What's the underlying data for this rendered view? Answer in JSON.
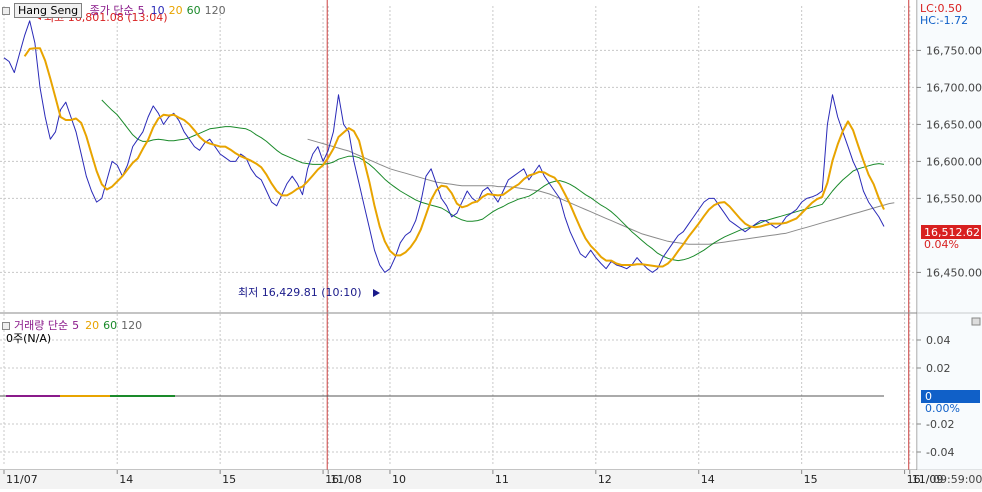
{
  "header": {
    "ticker": "Hang Seng",
    "price_ma_label": "종가 단순",
    "ma_periods": [
      "5",
      "10",
      "20",
      "60",
      "120"
    ],
    "lc": "LC:0.50",
    "hc": "HC:-1.72"
  },
  "volume_header": {
    "label": "거래량 단순",
    "ma_periods": [
      "5",
      "20",
      "60",
      "120"
    ],
    "status": "0주(N/A)"
  },
  "annotations": {
    "high": "최고 16,801.08 (13:04)",
    "low": "최저 16,429.81 (10:10)"
  },
  "current": {
    "price": "16,512.62",
    "change": "0.04%",
    "vol_value": "0",
    "vol_change": "0.00%"
  },
  "time_readout": "09:59:00",
  "colors": {
    "price": "#2a2ab8",
    "ma5": "#e8a400",
    "ma20": "#1a8a2a",
    "ma60": "#8b8b8b",
    "separator": "#cc4040",
    "price_tag": "#d82020",
    "vol_tag": "#1060c8",
    "axis_text": "#444444"
  },
  "chart_data": [
    {
      "type": "line",
      "panel": "price",
      "ylim": [
        16410,
        16810
      ],
      "yticks": [
        "16,750.00",
        "16,700.00",
        "16,650.00",
        "16,600.00",
        "16,550.00",
        "16,450.00"
      ],
      "ytick_values": [
        16750,
        16700,
        16650,
        16600,
        16550,
        16450
      ],
      "x_labels": [
        {
          "label": "11/07",
          "i": 0
        },
        {
          "label": "14",
          "i": 22
        },
        {
          "label": "15",
          "i": 42
        },
        {
          "label": "16",
          "i": 62
        },
        {
          "label": "11/08",
          "i": 63
        },
        {
          "label": "10",
          "i": 75
        },
        {
          "label": "11",
          "i": 95
        },
        {
          "label": "12",
          "i": 115
        },
        {
          "label": "14",
          "i": 135
        },
        {
          "label": "15",
          "i": 155
        },
        {
          "label": "16",
          "i": 175
        },
        {
          "label": "11/09",
          "i": 176
        }
      ],
      "day_separators": [
        63,
        176
      ],
      "series": [
        {
          "key": "price",
          "values": [
            16740,
            16735,
            16720,
            16745,
            16770,
            16790,
            16760,
            16700,
            16660,
            16630,
            16640,
            16670,
            16680,
            16660,
            16640,
            16610,
            16580,
            16560,
            16545,
            16550,
            16575,
            16600,
            16595,
            16580,
            16595,
            16620,
            16630,
            16640,
            16660,
            16675,
            16665,
            16650,
            16660,
            16665,
            16655,
            16640,
            16630,
            16620,
            16615,
            16625,
            16630,
            16620,
            16610,
            16605,
            16600,
            16600,
            16610,
            16605,
            16590,
            16580,
            16575,
            16560,
            16545,
            16540,
            16555,
            16570,
            16580,
            16570,
            16555,
            16590,
            16610,
            16620,
            16600,
            16615,
            16640,
            16690,
            16650,
            16640,
            16600,
            16570,
            16540,
            16510,
            16480,
            16460,
            16450,
            16455,
            16470,
            16490,
            16500,
            16505,
            16520,
            16545,
            16580,
            16590,
            16570,
            16550,
            16540,
            16525,
            16530,
            16545,
            16560,
            16550,
            16545,
            16560,
            16565,
            16555,
            16545,
            16560,
            16575,
            16580,
            16585,
            16590,
            16575,
            16585,
            16595,
            16580,
            16570,
            16560,
            16550,
            16525,
            16505,
            16490,
            16475,
            16470,
            16480,
            16470,
            16462,
            16455,
            16465,
            16460,
            16458,
            16455,
            16460,
            16470,
            16462,
            16455,
            16450,
            16455,
            16470,
            16480,
            16490,
            16500,
            16505,
            16515,
            16525,
            16535,
            16545,
            16550,
            16550,
            16540,
            16530,
            16520,
            16515,
            16510,
            16505,
            16510,
            16515,
            16520,
            16520,
            16515,
            16510,
            16515,
            16525,
            16530,
            16535,
            16545,
            16550,
            16552,
            16555,
            16560,
            16650,
            16690,
            16660,
            16640,
            16620,
            16600,
            16585,
            16560,
            16545,
            16535,
            16525,
            16512
          ]
        },
        {
          "key": "ma5",
          "values": [
            null,
            null,
            null,
            null,
            16742,
            16752,
            16753,
            16753,
            16736,
            16712,
            16686,
            16660,
            16656,
            16656,
            16658,
            16652,
            16634,
            16610,
            16587,
            16569,
            16562,
            16566,
            16573,
            16580,
            16589,
            16598,
            16604,
            16617,
            16629,
            16646,
            16658,
            16663,
            16662,
            16663,
            16659,
            16656,
            16650,
            16642,
            16633,
            16627,
            16624,
            16622,
            16620,
            16620,
            16616,
            16611,
            16607,
            16604,
            16601,
            16597,
            16592,
            16582,
            16570,
            16560,
            16554,
            16554,
            16558,
            16563,
            16566,
            16573,
            16581,
            16589,
            16595,
            16605,
            16617,
            16633,
            16639,
            16645,
            16641,
            16628,
            16600,
            16572,
            16540,
            16512,
            16492,
            16479,
            16473,
            16473,
            16477,
            16484,
            16494,
            16508,
            16528,
            16548,
            16561,
            16567,
            16566,
            16557,
            16543,
            16538,
            16540,
            16544,
            16546,
            16552,
            16556,
            16555,
            16554,
            16555,
            16560,
            16565,
            16569,
            16576,
            16581,
            16583,
            16586,
            16585,
            16581,
            16578,
            16569,
            16556,
            16542,
            16526,
            16510,
            16496,
            16486,
            16479,
            16471,
            16466,
            16466,
            16462,
            16460,
            16460,
            16460,
            16461,
            16461,
            16460,
            16459,
            16458,
            16458,
            16462,
            16469,
            16479,
            16488,
            16498,
            16507,
            16516,
            16526,
            16535,
            16541,
            16544,
            16545,
            16539,
            16531,
            16523,
            16516,
            16512,
            16511,
            16512,
            16514,
            16516,
            16516,
            16516,
            16517,
            16520,
            16523,
            16530,
            16537,
            16544,
            16549,
            16552,
            16571,
            16601,
            16623,
            16641,
            16654,
            16642,
            16621,
            16601,
            16582,
            16569,
            16550,
            16535
          ]
        },
        {
          "key": "ma20",
          "values": [
            null,
            null,
            null,
            null,
            null,
            null,
            null,
            null,
            null,
            null,
            null,
            null,
            null,
            null,
            null,
            null,
            null,
            null,
            null,
            16683,
            16676,
            16669,
            16663,
            16654,
            16645,
            16636,
            16630,
            16627,
            16627,
            16629,
            16630,
            16629,
            16628,
            16628,
            16629,
            16630,
            16632,
            16635,
            16638,
            16641,
            16644,
            16645,
            16646,
            16647,
            16647,
            16646,
            16645,
            16644,
            16641,
            16636,
            16632,
            16627,
            16621,
            16615,
            16610,
            16607,
            16604,
            16601,
            16598,
            16597,
            16596,
            16596,
            16596,
            16597,
            16599,
            16603,
            16605,
            16607,
            16607,
            16605,
            16601,
            16596,
            16590,
            16583,
            16576,
            16570,
            16565,
            16560,
            16556,
            16552,
            16548,
            16545,
            16543,
            16541,
            16539,
            16537,
            16533,
            16528,
            16524,
            16521,
            16519,
            16519,
            16520,
            16522,
            16527,
            16532,
            16536,
            16539,
            16543,
            16546,
            16549,
            16551,
            16553,
            16557,
            16562,
            16567,
            16571,
            16573,
            16574,
            16572,
            16569,
            16565,
            16560,
            16555,
            16551,
            16546,
            16541,
            16537,
            16532,
            16526,
            16519,
            16512,
            16505,
            16499,
            16493,
            16487,
            16482,
            16476,
            16472,
            16469,
            16467,
            16466,
            16467,
            16469,
            16472,
            16476,
            16480,
            16485,
            16490,
            16494,
            16498,
            16501,
            16504,
            16507,
            16509,
            16511,
            16514,
            16517,
            16520,
            16522,
            16524,
            16526,
            16528,
            16530,
            16532,
            16534,
            16536,
            16538,
            16540,
            16542,
            16551,
            16560,
            16568,
            16575,
            16581,
            16587,
            16590,
            16592,
            16594,
            16596,
            16597,
            16596
          ]
        },
        {
          "key": "ma60",
          "values": [
            null,
            null,
            null,
            null,
            null,
            null,
            null,
            null,
            null,
            null,
            null,
            null,
            null,
            null,
            null,
            null,
            null,
            null,
            null,
            null,
            null,
            null,
            null,
            null,
            null,
            null,
            null,
            null,
            null,
            null,
            null,
            null,
            null,
            null,
            null,
            null,
            null,
            null,
            null,
            null,
            null,
            null,
            null,
            null,
            null,
            null,
            null,
            null,
            null,
            null,
            null,
            null,
            null,
            null,
            null,
            null,
            null,
            null,
            null,
            16630,
            16628,
            16626,
            16624,
            16622,
            16620,
            16618,
            16616,
            16614,
            16611,
            16608,
            16605,
            16602,
            16599,
            16596,
            16593,
            16590,
            16588,
            16586,
            16584,
            16582,
            16580,
            16578,
            16576,
            16574,
            16572,
            16571,
            16570,
            16569,
            16568,
            16567,
            16567,
            16567,
            16567,
            16567,
            16567,
            16567,
            16566,
            16566,
            16566,
            16565,
            16564,
            16563,
            16562,
            16561,
            16560,
            16558,
            16556,
            16553,
            16550,
            16547,
            16544,
            16541,
            16538,
            16535,
            16532,
            16529,
            16526,
            16523,
            16520,
            16517,
            16514,
            16511,
            16508,
            16505,
            16502,
            16500,
            16498,
            16496,
            16494,
            16492,
            16491,
            16490,
            16489,
            16488,
            16488,
            16488,
            16488,
            16488,
            16489,
            16490,
            16491,
            16492,
            16493,
            16494,
            16495,
            16496,
            16497,
            16498,
            16499,
            16500,
            16501,
            16502,
            16503,
            16505,
            16507,
            16509,
            16511,
            16513,
            16515,
            16517,
            16519,
            16521,
            16523,
            16525,
            16527,
            16529,
            16531,
            16533,
            16535,
            16537,
            16539,
            16541,
            16543,
            16544
          ]
        }
      ]
    },
    {
      "type": "line",
      "panel": "volume",
      "ylim": [
        -0.05,
        0.05
      ],
      "yticks": [
        "0.04",
        "0.02",
        "-0.02",
        "-0.04"
      ],
      "ytick_values": [
        0.04,
        0.02,
        -0.02,
        -0.04
      ],
      "series": [
        {
          "key": "volume",
          "value": 0
        }
      ]
    }
  ]
}
